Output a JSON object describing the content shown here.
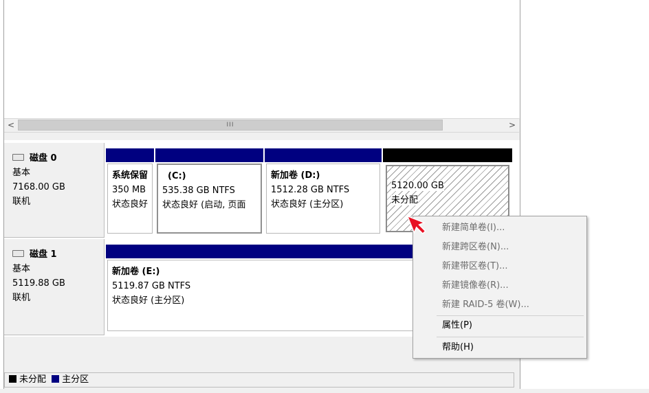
{
  "scrollbar": {
    "left_arrow": "<",
    "right_arrow": ">",
    "thumb_grip": "III"
  },
  "disks": [
    {
      "name": "磁盘 0",
      "type": "基本",
      "size": "7168.00 GB",
      "status": "联机",
      "volumes": [
        {
          "title": "系统保留",
          "size": "350 MB",
          "status": "状态良好"
        },
        {
          "title": "(C:)",
          "size": "535.38 GB NTFS",
          "status": "状态良好 (启动, 页面"
        },
        {
          "title": "新加卷  (D:)",
          "size": "1512.28 GB NTFS",
          "status": "状态良好 (主分区)"
        },
        {
          "title": "",
          "size": "5120.00 GB",
          "status": "未分配"
        }
      ]
    },
    {
      "name": "磁盘 1",
      "type": "基本",
      "size": "5119.88 GB",
      "status": "联机",
      "volumes": [
        {
          "title": "新加卷  (E:)",
          "size": "5119.87 GB NTFS",
          "status": "状态良好 (主分区)"
        }
      ]
    }
  ],
  "legend": [
    {
      "label": "未分配",
      "color": "#000000"
    },
    {
      "label": "主分区",
      "color": "#000080"
    }
  ],
  "context_menu": {
    "items": [
      {
        "label": "新建简单卷(I)...",
        "enabled": false
      },
      {
        "label": "新建跨区卷(N)...",
        "enabled": false
      },
      {
        "label": "新建带区卷(T)...",
        "enabled": false
      },
      {
        "label": "新建镜像卷(R)...",
        "enabled": false
      },
      {
        "label": "新建 RAID-5 卷(W)...",
        "enabled": false
      },
      {
        "label": "属性(P)",
        "enabled": true
      },
      {
        "label": "帮助(H)",
        "enabled": true
      }
    ]
  },
  "icons": {
    "disk": "hard-disk-icon",
    "cursor": "red-arrow-cursor-icon"
  },
  "colors": {
    "primary_partition": "#000080",
    "unallocated": "#000000",
    "cursor": "#e81123"
  }
}
